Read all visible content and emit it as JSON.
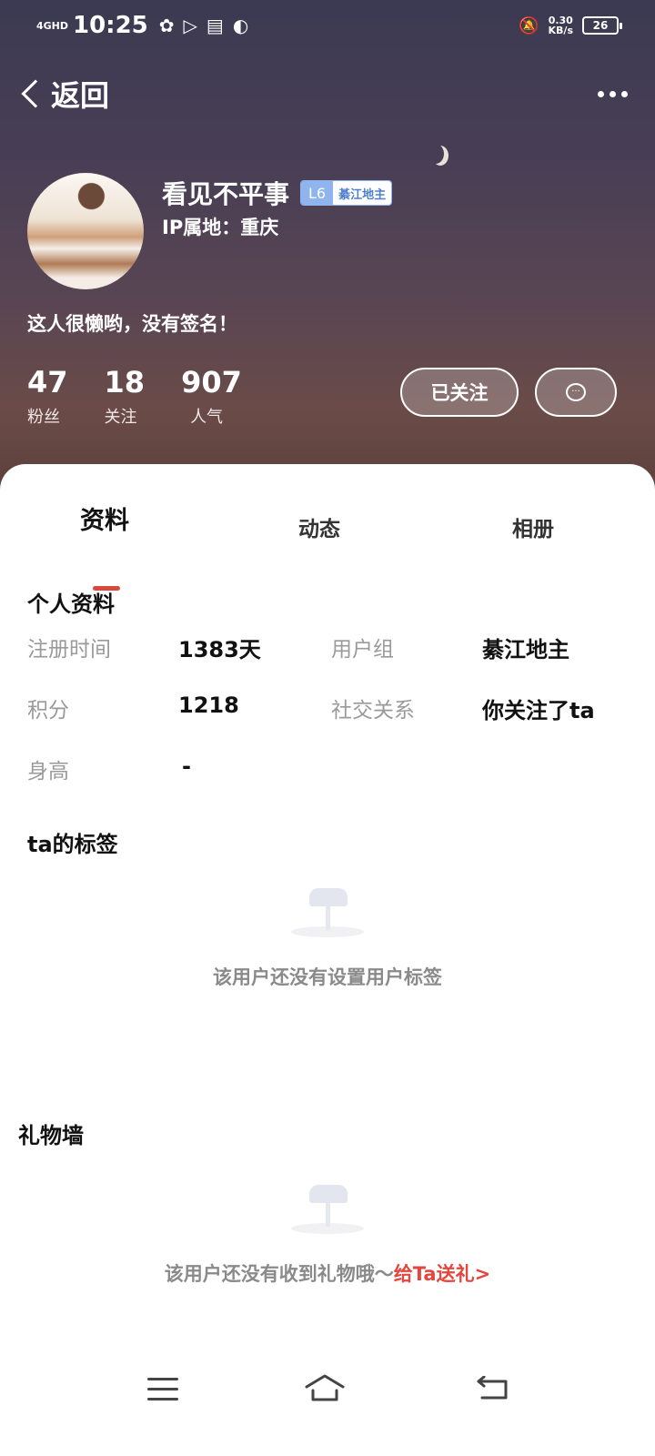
{
  "status_bar": {
    "network": "4GHD",
    "time": "10:25",
    "speed_value": "0.30",
    "speed_unit": "KB/s",
    "battery": "26"
  },
  "nav": {
    "back_label": "返回"
  },
  "profile": {
    "username": "看见不平事",
    "level": "L6",
    "group_badge": "綦江地主",
    "ip_label": "IP属地：",
    "ip_value": "重庆",
    "signature": "这人很懒哟，没有签名！",
    "stats": [
      {
        "value": "47",
        "label": "粉丝"
      },
      {
        "value": "18",
        "label": "关注"
      },
      {
        "value": "907",
        "label": "人气"
      }
    ],
    "follow_button": "已关注"
  },
  "tabs": [
    {
      "label": "资料",
      "active": true
    },
    {
      "label": "动态",
      "active": false
    },
    {
      "label": "相册",
      "active": false
    }
  ],
  "personal_info": {
    "title": "个人资料",
    "fields": {
      "register_time": {
        "label": "注册时间",
        "value": "1383天"
      },
      "user_group": {
        "label": "用户组",
        "value": "綦江地主"
      },
      "points": {
        "label": "积分",
        "value": "1218"
      },
      "social": {
        "label": "社交关系",
        "value": "你关注了ta"
      },
      "height": {
        "label": "身高",
        "value": "-"
      }
    }
  },
  "tags": {
    "title": "ta的标签",
    "empty_text": "该用户还没有设置用户标签"
  },
  "gifts": {
    "title": "礼物墙",
    "empty_text": "该用户还没有收到礼物哦～",
    "gift_link": "给Ta送礼>"
  },
  "colors": {
    "accent": "#d9493e",
    "link": "#e4463d",
    "badge_blue": "#8fb4ee"
  }
}
